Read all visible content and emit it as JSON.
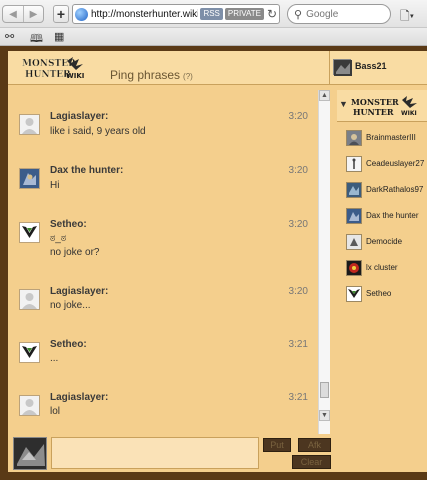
{
  "browser": {
    "url": "http://monsterhunter.wikia.",
    "rss_badge": "RSS",
    "private_badge": "PRIVATE",
    "search_placeholder": "Google"
  },
  "header": {
    "logo_text": "MONSTER HUNTER",
    "wiki_label": "WIKI",
    "ping_phrases": "Ping phrases",
    "ping_help": "(?)",
    "current_user": "Bass21"
  },
  "messages": [
    {
      "user": "Lagiaslayer:",
      "time": "3:20",
      "lines": [
        "like i said, 9 years old"
      ]
    },
    {
      "user": "Dax the hunter:",
      "time": "3:20",
      "lines": [
        "Hi"
      ]
    },
    {
      "user": "Setheo:",
      "time": "3:20",
      "lines": [
        "ಠ_ಠ",
        "no joke or?"
      ]
    },
    {
      "user": "Lagiaslayer:",
      "time": "3:20",
      "lines": [
        "no joke..."
      ]
    },
    {
      "user": "Setheo:",
      "time": "3:21",
      "lines": [
        "..."
      ]
    },
    {
      "user": "Lagiaslayer:",
      "time": "3:21",
      "lines": [
        "lol"
      ]
    }
  ],
  "buttons": {
    "btn1": "Put",
    "btn2": "Afk",
    "clear": "Clear"
  },
  "userlist": [
    {
      "name": "BrainmasterIII"
    },
    {
      "name": "Ceadeuslayer27"
    },
    {
      "name": "DarkRathalos97"
    },
    {
      "name": "Dax the hunter"
    },
    {
      "name": "Democide"
    },
    {
      "name": "lx cluster"
    },
    {
      "name": "Setheo"
    }
  ]
}
